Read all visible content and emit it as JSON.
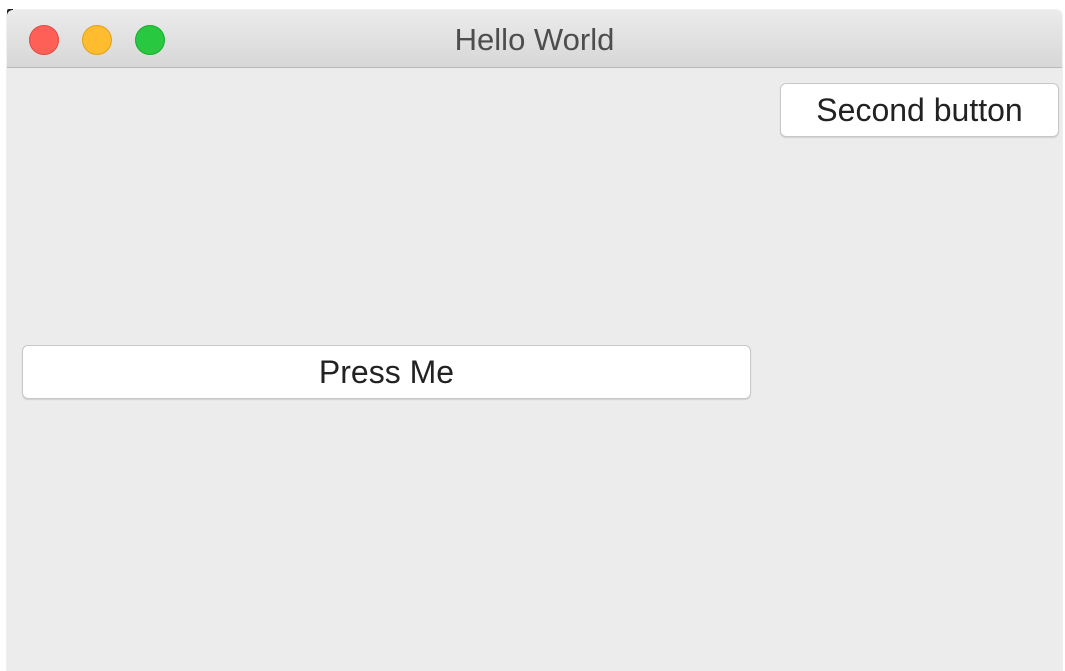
{
  "window": {
    "title": "Hello World"
  },
  "buttons": {
    "second": "Second button",
    "press": "Press Me"
  },
  "colors": {
    "close": "#fe5f57",
    "minimize": "#febc2e",
    "maximize": "#28c840",
    "window_bg": "#ececec",
    "button_bg": "#ffffff"
  }
}
